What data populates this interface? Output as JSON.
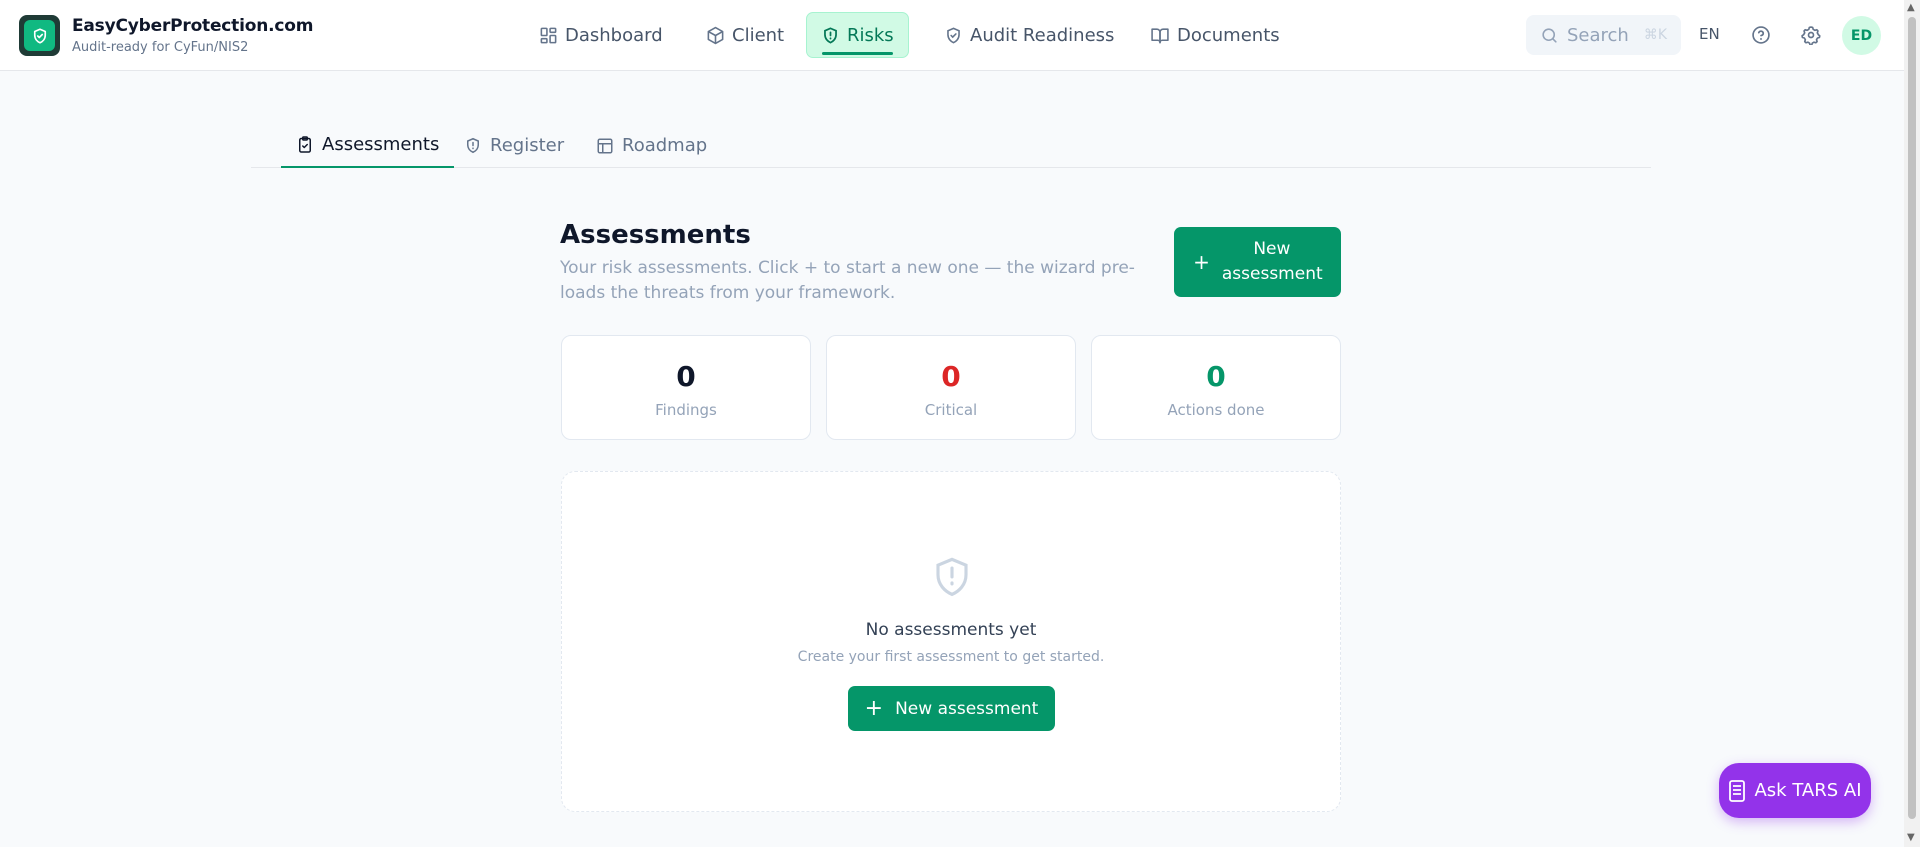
{
  "app": {
    "title": "EasyCyberProtection.com",
    "subtitle": "Audit-ready for CyFun/NIS2"
  },
  "nav": {
    "items": [
      {
        "label": "Dashboard",
        "icon": "grid-icon"
      },
      {
        "label": "Client",
        "icon": "box-icon"
      },
      {
        "label": "Risks",
        "icon": "shield-alert-icon",
        "active": true
      },
      {
        "label": "Audit Readiness",
        "icon": "shield-check-icon"
      },
      {
        "label": "Documents",
        "icon": "book-icon"
      }
    ]
  },
  "header": {
    "search_placeholder": "Search",
    "search_shortcut": "⌘K",
    "language": "EN",
    "avatar_initials": "ED"
  },
  "subtabs": [
    {
      "label": "Assessments",
      "icon": "clipboard-check-icon",
      "active": true
    },
    {
      "label": "Register",
      "icon": "shield-alert-icon"
    },
    {
      "label": "Roadmap",
      "icon": "layout-icon"
    }
  ],
  "main": {
    "title": "Assessments",
    "description": "Your risk assessments. Click + to start a new one — the wizard pre-loads the threats from your framework.",
    "new_button_label": "New assessment",
    "stats": [
      {
        "value": "0",
        "label": "Findings",
        "color": "#0f172a"
      },
      {
        "value": "0",
        "label": "Critical",
        "color": "#dc2626"
      },
      {
        "value": "0",
        "label": "Actions done",
        "color": "#059669"
      }
    ],
    "empty": {
      "title": "No assessments yet",
      "subtitle": "Create your first assessment to get started.",
      "button_label": "New assessment"
    }
  },
  "assistant": {
    "label": "Ask TARS AI"
  },
  "colors": {
    "accent": "#059669",
    "assistant": "#9333ea"
  }
}
